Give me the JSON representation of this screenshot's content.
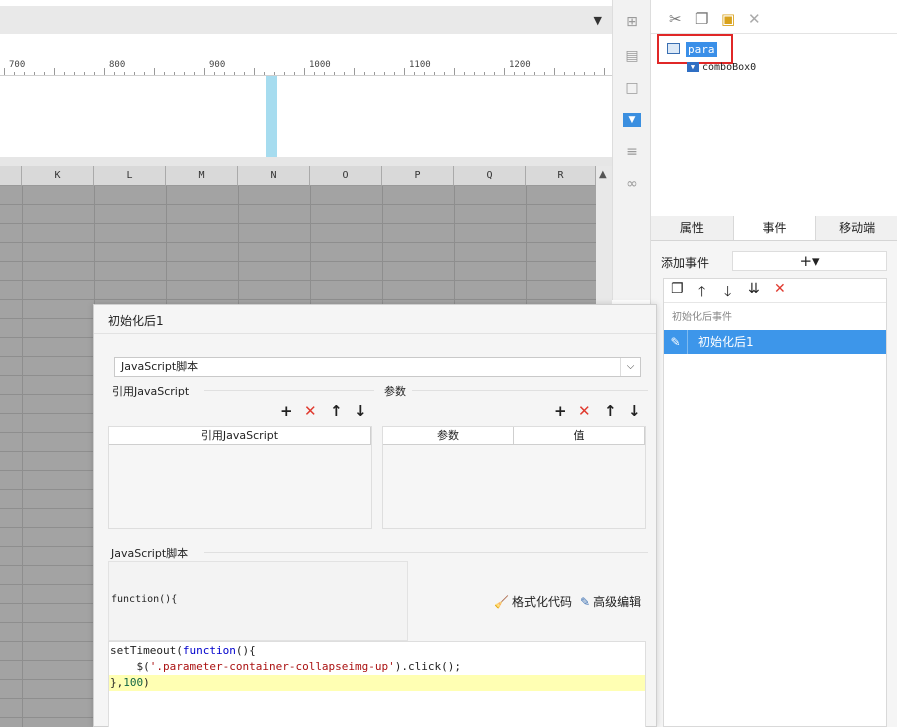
{
  "ruler": {
    "ticks": [
      "700",
      "800",
      "900",
      "1000",
      "1100",
      "1200"
    ]
  },
  "sheet": {
    "columns": [
      "K",
      "L",
      "M",
      "N",
      "O",
      "P",
      "Q",
      "R"
    ]
  },
  "right_panel": {
    "tree": {
      "root": "para",
      "child": "comboBox0"
    },
    "tabs": [
      "属性",
      "事件",
      "移动端"
    ],
    "add_event_label": "添加事件",
    "add_event_button": "+▾",
    "event_group": "初始化后事件",
    "event_item": "初始化后1"
  },
  "dialog": {
    "title": "初始化后1",
    "script_type": "JavaScript脚本",
    "ref_js_label": "引用JavaScript",
    "params_label": "参数",
    "ref_js_header": "引用JavaScript",
    "param_headers": [
      "参数",
      "值"
    ],
    "script_label": "JavaScript脚本",
    "fn_header": "function(){",
    "format_button": "格式化代码",
    "advanced_button": "高级编辑",
    "code": {
      "line1_kw1": "setTimeout(",
      "line1_kw2": "function",
      "line1_rest": "(){",
      "line2_pre": "    $(",
      "line2_str": "'.parameter-container-collapseimg-up'",
      "line2_post": ").click();",
      "line3_pre": "},",
      "line3_num": "100",
      "line3_post": ")"
    }
  },
  "colors": {
    "accent": "#3d96ea",
    "delete": "#e03a2f",
    "highlight": "#ffffb3",
    "selection_border": "#e02727"
  }
}
